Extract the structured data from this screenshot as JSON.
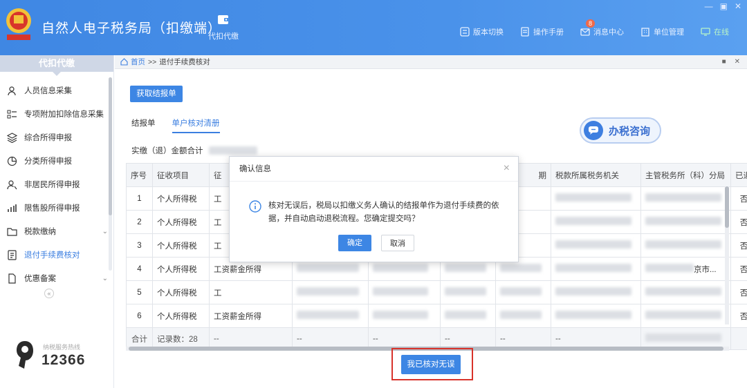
{
  "app": {
    "title": "自然人电子税务局（扣缴端）",
    "feature_button": "代扣代缴",
    "header_links": [
      {
        "label": "版本切换",
        "icon": "switch-icon"
      },
      {
        "label": "操作手册",
        "icon": "manual-icon"
      },
      {
        "label": "消息中心",
        "icon": "mail-icon",
        "badge": "8"
      },
      {
        "label": "单位管理",
        "icon": "building-icon"
      },
      {
        "label": "在线",
        "icon": "online-icon"
      }
    ]
  },
  "sidebar": {
    "heading": "代扣代缴",
    "items": [
      {
        "label": "人员信息采集",
        "icon": "person-icon"
      },
      {
        "label": "专项附加扣除信息采集",
        "icon": "list-icon"
      },
      {
        "label": "综合所得申报",
        "icon": "layers-icon"
      },
      {
        "label": "分类所得申报",
        "icon": "pie-icon"
      },
      {
        "label": "非居民所得申报",
        "icon": "person-alt-icon"
      },
      {
        "label": "限售股所得申报",
        "icon": "bar-chart-icon"
      },
      {
        "label": "税款缴纳",
        "icon": "folder-icon",
        "chevron": "⌄"
      },
      {
        "label": "退付手续费核对",
        "icon": "doc-check-icon",
        "active": true
      },
      {
        "label": "优惠备案",
        "icon": "doc-icon",
        "chevron": "⌄"
      }
    ],
    "collapse": "«",
    "hotline_caption": "纳税服务热线",
    "hotline_number": "12366"
  },
  "breadcrumb": {
    "home": "首页",
    "sep": ">>",
    "current": "退付手续费核对"
  },
  "main": {
    "get_button": "获取结报单",
    "tabs": [
      "结报单",
      "单户核对清册"
    ],
    "consult_label": "办税咨询",
    "amount_label": "实缴（退）金额合计"
  },
  "table": {
    "headers": [
      "序号",
      "征收项目",
      "征",
      "",
      "",
      "",
      "期",
      "税款所属税务机关",
      "主管税务所（科）分局",
      "已退"
    ],
    "rows": [
      {
        "no": "1",
        "project": "个人所得税",
        "item": "工",
        "refunded": "否"
      },
      {
        "no": "2",
        "project": "个人所得税",
        "item": "工",
        "refunded": "否"
      },
      {
        "no": "3",
        "project": "个人所得税",
        "item": "工",
        "refunded": "否"
      },
      {
        "no": "4",
        "project": "个人所得税",
        "item": "工资薪金所得",
        "office_tail": "京市...",
        "refunded": "否"
      },
      {
        "no": "5",
        "project": "个人所得税",
        "item": "工",
        "refunded": "否"
      },
      {
        "no": "6",
        "project": "个人所得税",
        "item": "工资薪金所得",
        "refunded": "否"
      }
    ],
    "footer": {
      "total_label": "合计",
      "count": "记录数：28",
      "dash": "--"
    }
  },
  "confirm_button": "我已核对无误",
  "dialog": {
    "title": "确认信息",
    "close": "×",
    "message": "核对无误后，税局以扣缴义务人确认的结报单作为退付手续费的依据，并自动启动退税流程。您确定提交吗？",
    "ok": "确定",
    "cancel": "取消"
  }
}
